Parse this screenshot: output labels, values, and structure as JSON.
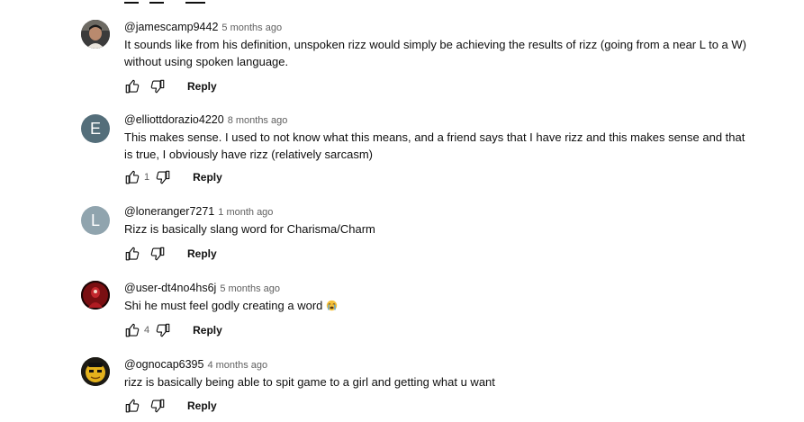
{
  "comments": [
    {
      "handle": "@jamescamp9442",
      "time": "5 months ago",
      "text": "It sounds like from his definition, unspoken rizz would simply be achieving the results of rizz (going from a near L to a W) without using spoken language.",
      "like_count": "",
      "reply_label": "Reply",
      "avatar": {
        "type": "photo",
        "bg": "#2b2b2b"
      }
    },
    {
      "handle": "@elliottdorazio4220",
      "time": "8 months ago",
      "text": "This makes sense. I used to not know what this means, and a friend says that I have rizz and this makes sense and that is true, I obviously have rizz (relatively sarcasm)",
      "like_count": "1",
      "reply_label": "Reply",
      "avatar": {
        "type": "letter",
        "letter": "E",
        "bg": "#546e7a"
      }
    },
    {
      "handle": "@loneranger7271",
      "time": "1 month ago",
      "text": "Rizz is basically slang word for Charisma/Charm",
      "like_count": "",
      "reply_label": "Reply",
      "avatar": {
        "type": "letter",
        "letter": "L",
        "bg": "#90a4ae"
      }
    },
    {
      "handle": "@user-dt4no4hs6j",
      "time": "5 months ago",
      "text": "Shi he must feel godly creating a word",
      "emoji": "loudly-crying-face",
      "like_count": "4",
      "reply_label": "Reply",
      "avatar": {
        "type": "photo",
        "bg": "#3a0a0a"
      }
    },
    {
      "handle": "@ognocap6395",
      "time": "4 months ago",
      "text": "rizz is basically being able to spit game to a girl and getting what u want",
      "like_count": "",
      "reply_label": "Reply",
      "avatar": {
        "type": "photo",
        "bg": "#1c1a14"
      }
    }
  ],
  "icons": {
    "like": "thumbs-up-icon",
    "dislike": "thumbs-down-icon"
  }
}
